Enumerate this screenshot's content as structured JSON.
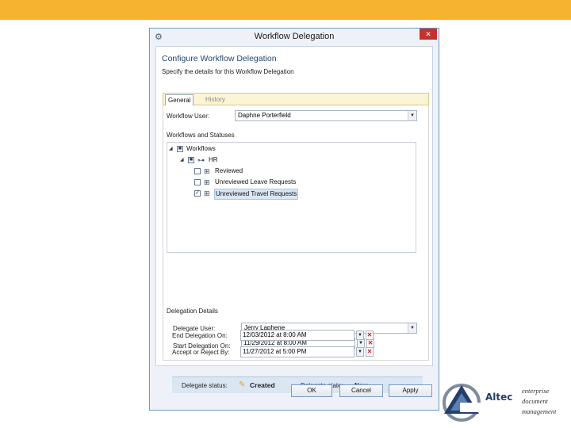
{
  "window": {
    "title": "Workflow Delegation",
    "close_label": "✕"
  },
  "header": {
    "title": "Configure Workflow Delegation",
    "subtitle": "Specify the details for this Workflow Delegation"
  },
  "tabs": [
    {
      "label": "General",
      "selected": true
    },
    {
      "label": "History",
      "selected": false
    }
  ],
  "workflow_user": {
    "label": "Workflow User:",
    "value": "Daphne Porterfield"
  },
  "workflows_section": {
    "label": "Workflows and Statuses",
    "tree": {
      "root": {
        "label": "Workflows",
        "checked": "partial",
        "expanded": true
      },
      "group": {
        "label": "HR",
        "checked": "partial",
        "expanded": true
      },
      "items": [
        {
          "label": "Reviewed",
          "checked": false
        },
        {
          "label": "Unreviewed Leave Requests",
          "checked": false
        },
        {
          "label": "Unreviewed Travel Requests",
          "checked": true,
          "selected": true
        }
      ]
    }
  },
  "delegation": {
    "section_label": "Delegation Details",
    "delegate_user": {
      "label": "Delegate User:",
      "value": "Jerry Laphene"
    },
    "start": {
      "label": "Start Delegation On:",
      "value": "11/29/2012 at 8:00 AM"
    },
    "end": {
      "label": "End Delegation On:",
      "value": "12/03/2012 at 8:00 AM"
    },
    "accept": {
      "label": "Accept or Reject By:",
      "value": "11/27/2012 at 5:00 PM"
    }
  },
  "status": {
    "status_label": "Delegate status:",
    "status_value": "Created",
    "state_label": "Delegate state:",
    "state_value": "New"
  },
  "buttons": {
    "ok": "OK",
    "cancel": "Cancel",
    "apply": "Apply"
  },
  "logo": {
    "name": "Altec",
    "tagline": [
      "enterprise",
      "document",
      "management"
    ]
  },
  "colors": {
    "top_bar": "#f5b330",
    "accent": "#27466e",
    "close": "#c7302b"
  }
}
